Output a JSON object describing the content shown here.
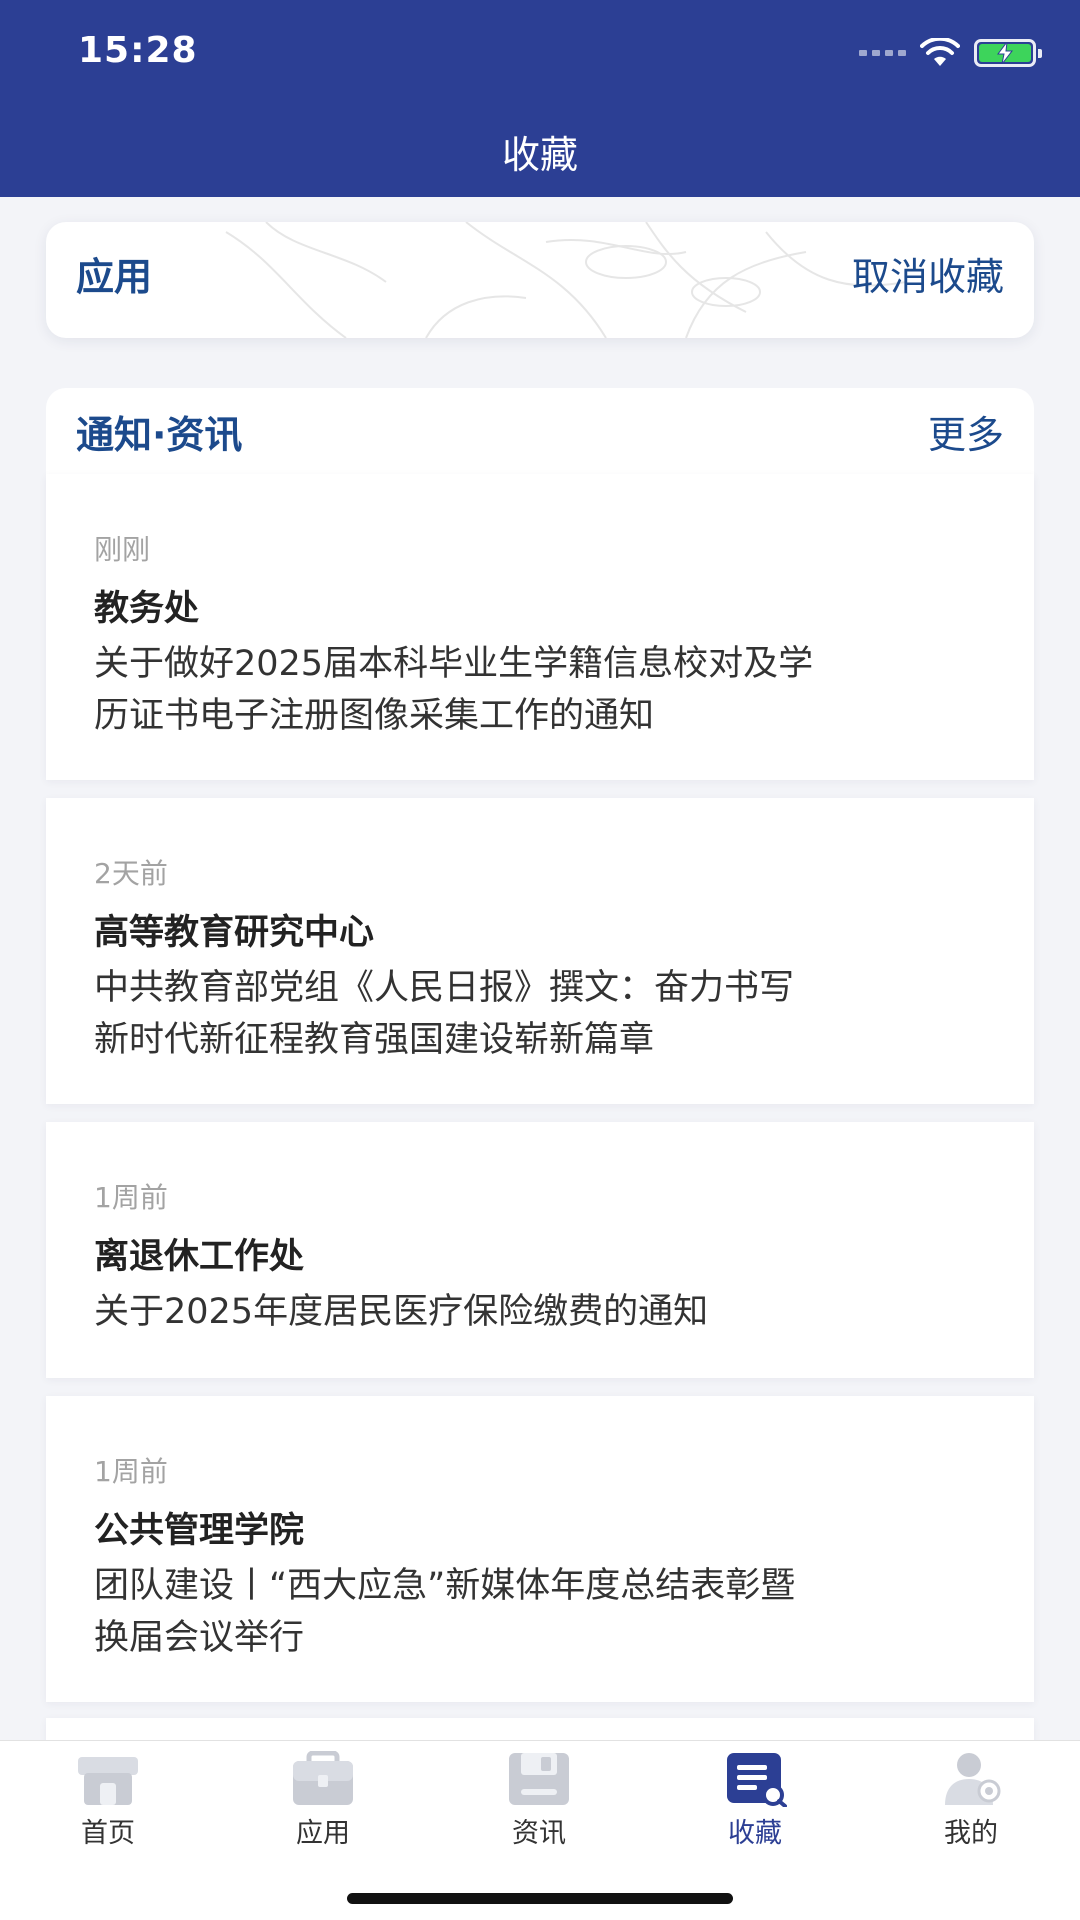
{
  "status_bar": {
    "time": "15:28"
  },
  "nav": {
    "title": "收藏"
  },
  "apps_section": {
    "title": "应用",
    "action": "取消收藏"
  },
  "news_section": {
    "title": "通知·资讯",
    "more": "更多",
    "items": [
      {
        "time": "刚刚",
        "source": "教务处",
        "title_line1": "关于做好2025届本科毕业生学籍信息校对及学",
        "title_line2": "历证书电子注册图像采集工作的通知"
      },
      {
        "time": "2天前",
        "source": "高等教育研究中心",
        "title_line1": "中共教育部党组《人民日报》撰文：奋力书写",
        "title_line2": "新时代新征程教育强国建设崭新篇章"
      },
      {
        "time": "1周前",
        "source": "离退休工作处",
        "title_line1": "关于2025年度居民医疗保险缴费的通知",
        "title_line2": ""
      },
      {
        "time": "1周前",
        "source": "公共管理学院",
        "title_line1": "团队建设丨“西大应急”新媒体年度总结表彰暨",
        "title_line2": "换届会议举行"
      }
    ]
  },
  "tabbar": {
    "active": "收藏",
    "items": [
      {
        "label": "首页",
        "icon": "home-icon"
      },
      {
        "label": "应用",
        "icon": "apps-icon"
      },
      {
        "label": "资讯",
        "icon": "news-icon"
      },
      {
        "label": "收藏",
        "icon": "favorites-icon"
      },
      {
        "label": "我的",
        "icon": "profile-icon"
      }
    ]
  },
  "colors": {
    "header": "#2c3f94",
    "accent_text": "#1c4a8c",
    "active_tab": "#2c3f94",
    "battery": "#3dd45b"
  }
}
